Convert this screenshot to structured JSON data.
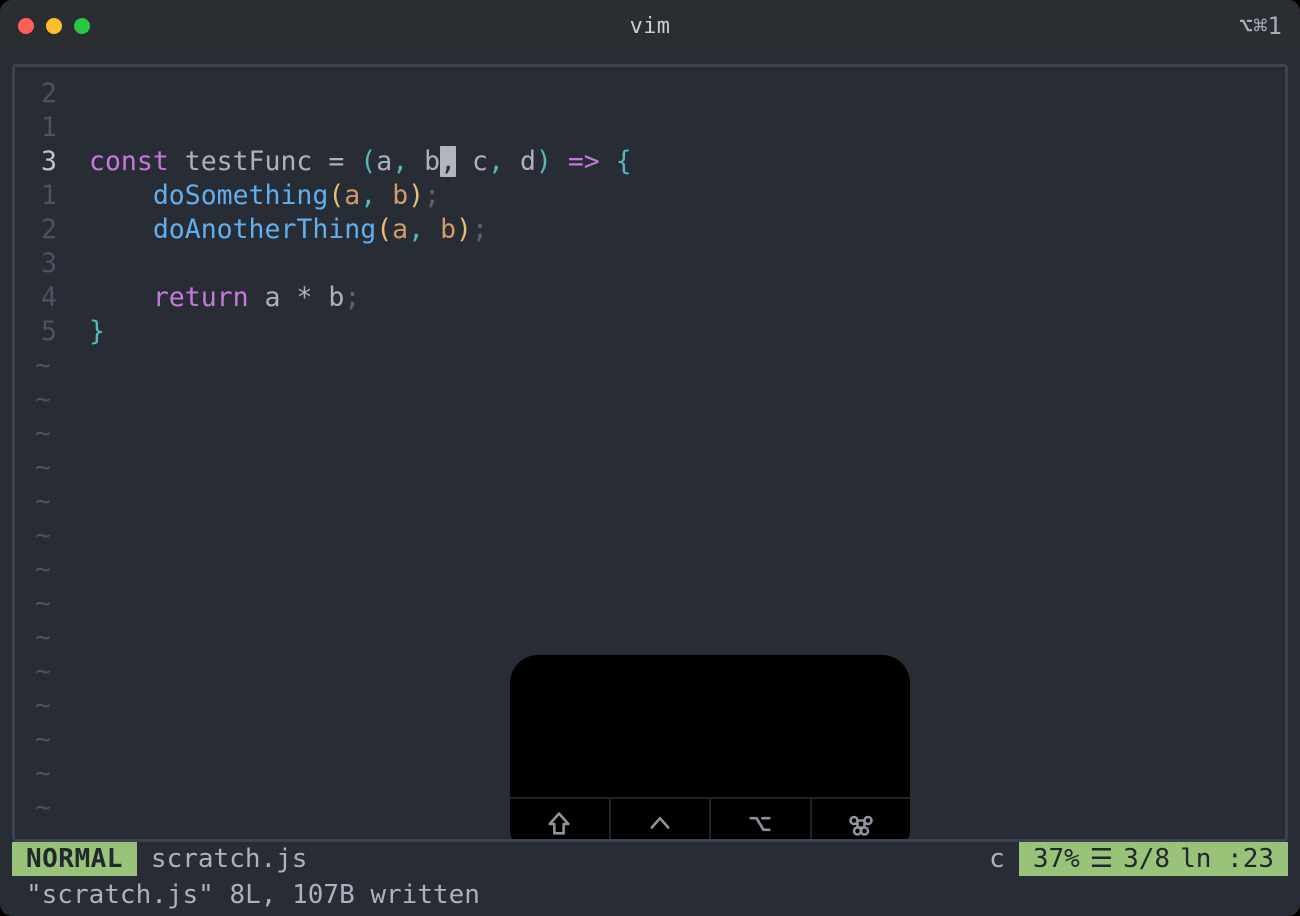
{
  "window": {
    "title": "vim",
    "shortcut_label": "⌥⌘1"
  },
  "status": {
    "mode": "NORMAL",
    "filename": "scratch.js",
    "pending": "c",
    "percent": "37%",
    "pos": "3/8",
    "col": "ln :23"
  },
  "echo": "\"scratch.js\" 8L, 107B written",
  "gutter": [
    "2",
    "1",
    "3",
    "1",
    "2",
    "3",
    "4",
    "5"
  ],
  "code": [
    [],
    [],
    [
      {
        "cls": "c-key",
        "t": "const"
      },
      {
        "cls": "c-op",
        "t": " testFunc "
      },
      {
        "cls": "c-op",
        "t": "= "
      },
      {
        "cls": "c-brace",
        "t": "("
      },
      {
        "cls": "c-param",
        "t": "a"
      },
      {
        "cls": "c-comma",
        "t": ","
      },
      {
        "cls": "c-op",
        "t": " "
      },
      {
        "cls": "c-param",
        "t": "b"
      },
      {
        "cls": "cursor-blk",
        "t": ","
      },
      {
        "cls": "c-op",
        "t": " "
      },
      {
        "cls": "c-param",
        "t": "c"
      },
      {
        "cls": "c-comma",
        "t": ","
      },
      {
        "cls": "c-op",
        "t": " "
      },
      {
        "cls": "c-param",
        "t": "d"
      },
      {
        "cls": "c-brace",
        "t": ")"
      },
      {
        "cls": "c-op",
        "t": " "
      },
      {
        "cls": "c-key",
        "t": "=>"
      },
      {
        "cls": "c-op",
        "t": " "
      },
      {
        "cls": "c-brace2",
        "t": "{"
      }
    ],
    [
      {
        "cls": "c-op",
        "t": "    "
      },
      {
        "cls": "c-func",
        "t": "doSomething"
      },
      {
        "cls": "c-punc",
        "t": "("
      },
      {
        "cls": "c-ident",
        "t": "a"
      },
      {
        "cls": "c-comma",
        "t": ","
      },
      {
        "cls": "c-op",
        "t": " "
      },
      {
        "cls": "c-ident",
        "t": "b"
      },
      {
        "cls": "c-punc",
        "t": ")"
      },
      {
        "cls": "c-semi",
        "t": ";"
      }
    ],
    [
      {
        "cls": "c-op",
        "t": "    "
      },
      {
        "cls": "c-func",
        "t": "doAnotherThing"
      },
      {
        "cls": "c-punc",
        "t": "("
      },
      {
        "cls": "c-ident",
        "t": "a"
      },
      {
        "cls": "c-comma",
        "t": ","
      },
      {
        "cls": "c-op",
        "t": " "
      },
      {
        "cls": "c-ident",
        "t": "b"
      },
      {
        "cls": "c-punc",
        "t": ")"
      },
      {
        "cls": "c-semi",
        "t": ";"
      }
    ],
    [],
    [
      {
        "cls": "c-op",
        "t": "    "
      },
      {
        "cls": "c-key",
        "t": "return"
      },
      {
        "cls": "c-op",
        "t": " a "
      },
      {
        "cls": "c-star",
        "t": "*"
      },
      {
        "cls": "c-op",
        "t": " b"
      },
      {
        "cls": "c-semi",
        "t": ";"
      }
    ],
    [
      {
        "cls": "c-brace2",
        "t": "}"
      }
    ]
  ],
  "tilde_rows": 14,
  "overlay": {
    "keys": [
      "shift",
      "control",
      "option",
      "command"
    ]
  }
}
